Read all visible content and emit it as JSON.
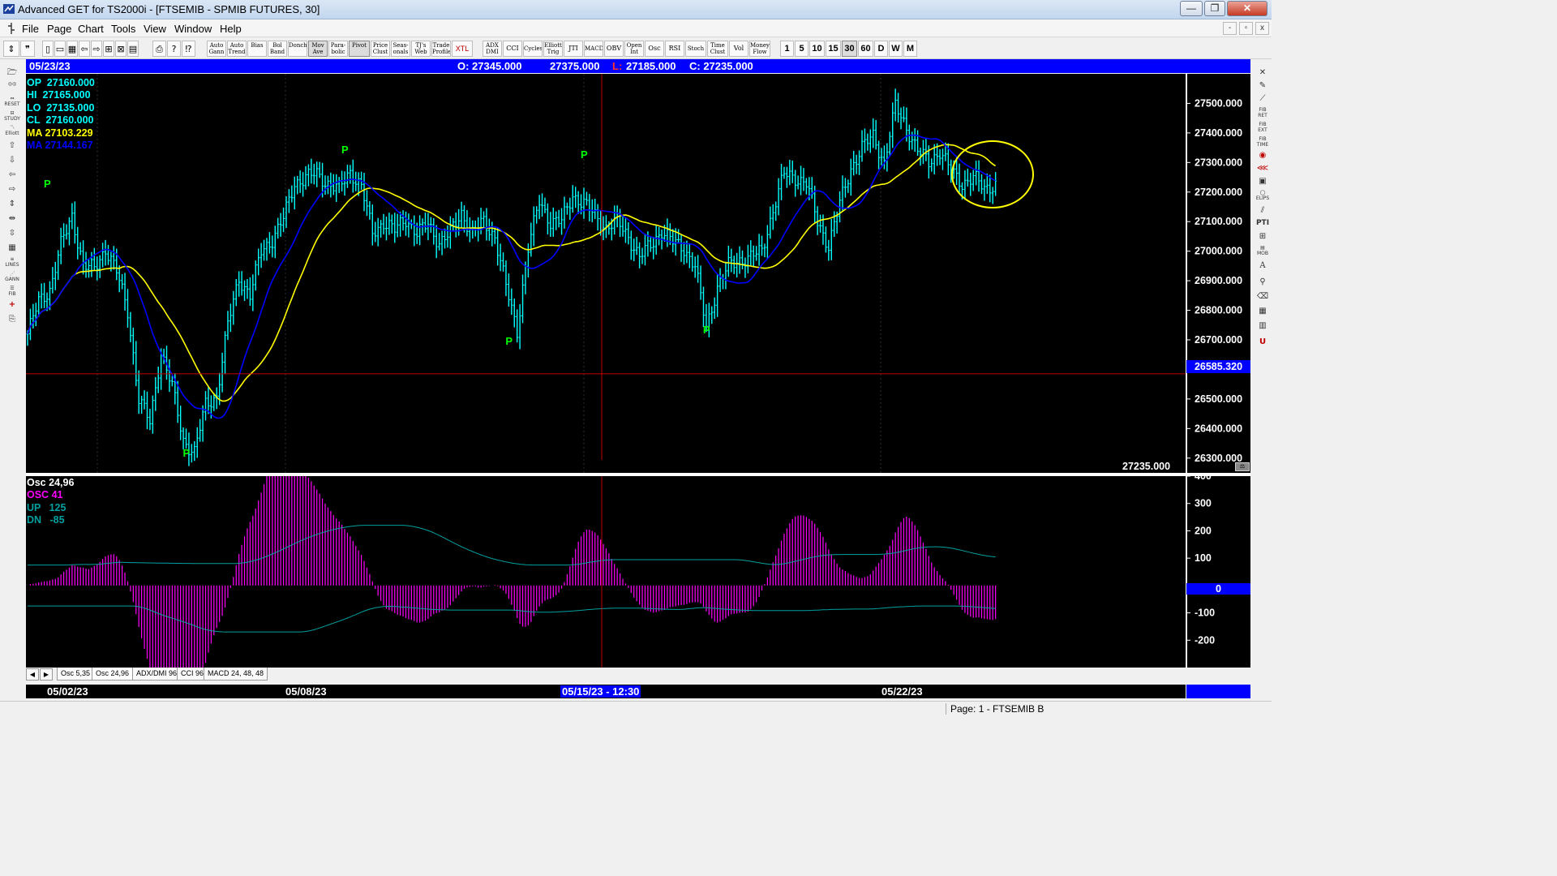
{
  "window": {
    "title": "Advanced GET for TS2000i - [FTSEMIB - SPMIB FUTURES, 30]",
    "minimize": "—",
    "maximize": "❐",
    "close": "✕"
  },
  "menu": {
    "items": [
      "File",
      "Page",
      "Chart",
      "Tools",
      "View",
      "Window",
      "Help"
    ],
    "mdi_controls": [
      "-",
      "▫",
      "x"
    ]
  },
  "toolbar": {
    "study_buttons": [
      "Auto Gann",
      "Auto Trend",
      "Bias",
      "Bol Band",
      "Donch",
      "Mov Ave",
      "Para-bolic",
      "Pivot",
      "Price Clust",
      "Seas-onals",
      "TJ's Web",
      "Trade Profile",
      "XTL",
      "ADX DMI",
      "CCI",
      "Cycles",
      "Elliott Trig",
      "JTI",
      "MACD",
      "OBV",
      "Open Int",
      "Osc",
      "RSI",
      "Stoch",
      "Time Clust",
      "Vol",
      "Money Flow"
    ],
    "timeframes": [
      "1",
      "5",
      "10",
      "15",
      "30",
      "60",
      "D",
      "W",
      "M"
    ],
    "active_timeframe": "30"
  },
  "header_bar": {
    "date": "05/23/23",
    "open": "O: 27345.000",
    "high": "27375.000",
    "low_label": "L:",
    "low_value": "27185.000",
    "close": "C: 27235.000"
  },
  "price_readout": [
    {
      "label": "OP",
      "value": "27160.000",
      "color": "#00ffff"
    },
    {
      "label": "HI",
      "value": "27165.000",
      "color": "#00ffff"
    },
    {
      "label": "LO",
      "value": "27135.000",
      "color": "#00ffff"
    },
    {
      "label": "CL",
      "value": "27160.000",
      "color": "#00ffff"
    },
    {
      "label": "MA",
      "value": "27103.229",
      "color": "#ffff00"
    },
    {
      "label": "MA",
      "value": "27144.167",
      "color": "#0000ff"
    }
  ],
  "price_axis": {
    "labels": [
      "27500.000",
      "27400.000",
      "27300.000",
      "27200.000",
      "27100.000",
      "27000.000",
      "26900.000",
      "26800.000",
      "26700.000",
      "26500.000",
      "26400.000",
      "26300.000"
    ],
    "cursor_price": "26585.320",
    "last_close_label": "27235.000"
  },
  "osc_readout": [
    {
      "label": "Osc",
      "value": "24,96",
      "color": "#ffffff"
    },
    {
      "label": "OSC",
      "value": "41",
      "color": "#ff00ff"
    },
    {
      "label": "UP",
      "value": "125",
      "color": "#00a0a0"
    },
    {
      "label": "DN",
      "value": "-85",
      "color": "#00a0a0"
    }
  ],
  "osc_axis": {
    "labels": [
      "400",
      "300",
      "200",
      "100",
      "-100",
      "-200"
    ],
    "zero_label": "0"
  },
  "tabs": {
    "items": [
      "Osc 5,35",
      "Osc 24,96",
      "ADX/DMI 96",
      "CCI 96",
      "MACD 24, 48, 48"
    ],
    "active": "Osc 24,96"
  },
  "time_axis": {
    "labels": [
      "05/02/23",
      "05/08/23",
      "05/22/23"
    ],
    "cursor_time": "05/15/23 - 12:30"
  },
  "status": {
    "page": "Page: 1 - FTSEMIB B"
  },
  "pivot_marker": "P",
  "colors": {
    "price_bars": "#00ffff",
    "ma_fast": "#0000ff",
    "ma_slow": "#ffff00",
    "osc_hist": "#ff00ff",
    "bands": "#00a0a0",
    "cursor": "#c00000",
    "pivot": "#00ff00"
  },
  "chart_data": {
    "type": "line",
    "series": [
      {
        "name": "MA",
        "values": []
      },
      {
        "name": "MA",
        "values": []
      }
    ],
    "price_anchors": [
      [
        0,
        26720
      ],
      [
        4,
        26830
      ],
      [
        8,
        26870
      ],
      [
        12,
        27020
      ],
      [
        16,
        27120
      ],
      [
        20,
        26950
      ],
      [
        24,
        26940
      ],
      [
        28,
        27010
      ],
      [
        32,
        26930
      ],
      [
        36,
        26800
      ],
      [
        40,
        26500
      ],
      [
        44,
        26420
      ],
      [
        48,
        26660
      ],
      [
        52,
        26540
      ],
      [
        56,
        26360
      ],
      [
        60,
        26320
      ],
      [
        64,
        26480
      ],
      [
        68,
        26510
      ],
      [
        72,
        26750
      ],
      [
        76,
        26910
      ],
      [
        80,
        26850
      ],
      [
        84,
        27000
      ],
      [
        88,
        27040
      ],
      [
        92,
        27110
      ],
      [
        96,
        27230
      ],
      [
        100,
        27250
      ],
      [
        104,
        27260
      ],
      [
        108,
        27230
      ],
      [
        112,
        27210
      ],
      [
        116,
        27270
      ],
      [
        120,
        27220
      ],
      [
        124,
        27060
      ],
      [
        128,
        27100
      ],
      [
        132,
        27070
      ],
      [
        136,
        27110
      ],
      [
        140,
        27060
      ],
      [
        144,
        27090
      ],
      [
        148,
        27030
      ],
      [
        152,
        27060
      ],
      [
        156,
        27130
      ],
      [
        160,
        27060
      ],
      [
        164,
        27100
      ],
      [
        168,
        27050
      ],
      [
        172,
        26880
      ],
      [
        176,
        26730
      ],
      [
        178,
        26880
      ],
      [
        180,
        27010
      ],
      [
        184,
        27170
      ],
      [
        188,
        27100
      ],
      [
        192,
        27100
      ],
      [
        196,
        27190
      ],
      [
        200,
        27160
      ],
      [
        204,
        27120
      ],
      [
        208,
        27080
      ],
      [
        212,
        27100
      ],
      [
        216,
        27050
      ],
      [
        220,
        26980
      ],
      [
        224,
        27020
      ],
      [
        228,
        27070
      ],
      [
        232,
        27030
      ],
      [
        236,
        27010
      ],
      [
        240,
        26950
      ],
      [
        244,
        26740
      ],
      [
        248,
        26880
      ],
      [
        252,
        26950
      ],
      [
        256,
        26970
      ],
      [
        260,
        26980
      ],
      [
        264,
        27000
      ],
      [
        268,
        27140
      ],
      [
        272,
        27260
      ],
      [
        276,
        27250
      ],
      [
        280,
        27230
      ],
      [
        284,
        27100
      ],
      [
        288,
        27020
      ],
      [
        292,
        27160
      ],
      [
        296,
        27280
      ],
      [
        300,
        27350
      ],
      [
        304,
        27390
      ],
      [
        308,
        27300
      ],
      [
        312,
        27490
      ],
      [
        316,
        27420
      ],
      [
        320,
        27340
      ],
      [
        324,
        27300
      ],
      [
        328,
        27340
      ],
      [
        332,
        27270
      ],
      [
        336,
        27230
      ],
      [
        340,
        27250
      ],
      [
        344,
        27210
      ],
      [
        348,
        27230
      ]
    ],
    "ylim": [
      26250,
      27600
    ],
    "osc_ylim": [
      -300,
      400
    ]
  }
}
